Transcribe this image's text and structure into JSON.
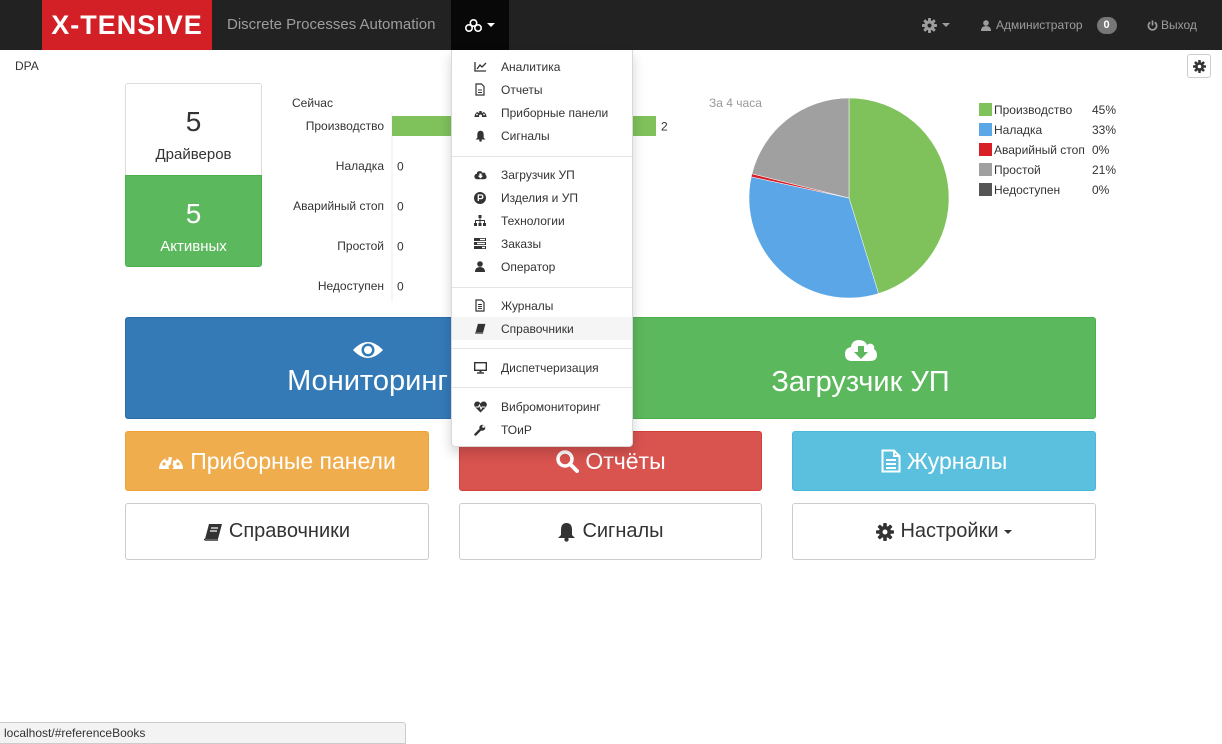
{
  "navbar": {
    "brand": "X-TENSIVE",
    "title": "Discrete Processes Automation",
    "user": "Администратор",
    "badge": "0",
    "logout": "Выход"
  },
  "breadcrumb": "DPA",
  "counters": {
    "drivers_num": "5",
    "drivers_label": "Драйверов",
    "active_num": "5",
    "active_label": "Активных"
  },
  "now": {
    "title": "Сейчас",
    "rows": [
      {
        "label": "Производство",
        "value": 2
      },
      {
        "label": "Наладка",
        "value": 0
      },
      {
        "label": "Аварийный стоп",
        "value": 0
      },
      {
        "label": "Простой",
        "value": 0
      },
      {
        "label": "Недоступен",
        "value": 0
      }
    ]
  },
  "chart_data": {
    "type": "pie",
    "title": "За 4 часа",
    "categories": [
      "Производство",
      "Наладка",
      "Аварийный стоп",
      "Простой",
      "Недоступен"
    ],
    "values": [
      45,
      33,
      0.5,
      21,
      0
    ],
    "labels": [
      "45%",
      "33%",
      "0%",
      "21%",
      "0%"
    ],
    "colors": [
      "#7fc15b",
      "#5aa6e6",
      "#d81f26",
      "#a0a0a0",
      "#555555"
    ],
    "legend": "right"
  },
  "colors": {
    "green": "#7fc15b",
    "blue": "#5aa6e6",
    "red": "#d81f26",
    "gray": "#a0a0a0",
    "dark": "#555555"
  },
  "tiles": {
    "monitoring": "Мониторинг",
    "loader": "Загрузчик УП",
    "panels": "Приборные панели",
    "reports": "Отчёты",
    "journals": "Журналы",
    "refbooks": "Справочники",
    "signals": "Сигналы",
    "settings": "Настройки"
  },
  "menu": [
    {
      "label": "Аналитика",
      "icon": "line-chart-icon"
    },
    {
      "label": "Отчеты",
      "icon": "file-icon"
    },
    {
      "label": "Приборные панели",
      "icon": "dashboard-icon"
    },
    {
      "label": "Сигналы",
      "icon": "bell-icon"
    },
    {
      "label": "Загрузчик УП",
      "icon": "cloud-download-icon"
    },
    {
      "label": "Изделия и УП",
      "icon": "product-icon"
    },
    {
      "label": "Технологии",
      "icon": "sitemap-icon"
    },
    {
      "label": "Заказы",
      "icon": "tasks-icon"
    },
    {
      "label": "Оператор",
      "icon": "user-icon"
    },
    {
      "label": "Журналы",
      "icon": "file-text-icon"
    },
    {
      "label": "Справочники",
      "icon": "book-icon"
    },
    {
      "label": "Диспетчеризация",
      "icon": "desktop-icon"
    },
    {
      "label": "Вибромониторинг",
      "icon": "heartbeat-icon"
    },
    {
      "label": "ТОиР",
      "icon": "wrench-icon"
    }
  ],
  "statusbar": "localhost/#referenceBooks"
}
